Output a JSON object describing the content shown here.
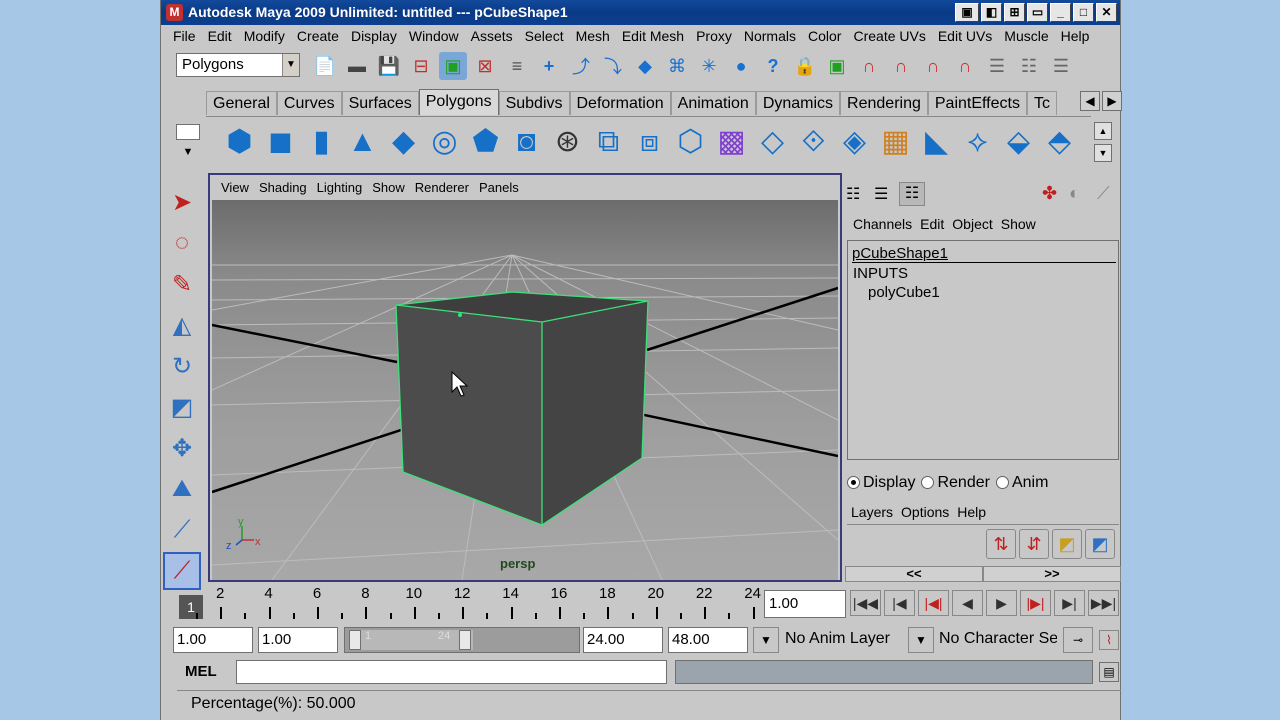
{
  "window": {
    "title": "Autodesk Maya 2009 Unlimited: untitled   ---   pCubeShape1"
  },
  "menubar": [
    "File",
    "Edit",
    "Modify",
    "Create",
    "Display",
    "Window",
    "Assets",
    "Select",
    "Mesh",
    "Edit Mesh",
    "Proxy",
    "Normals",
    "Color",
    "Create UVs",
    "Edit UVs",
    "Muscle",
    "Help"
  ],
  "status_line": {
    "mode": "Polygons"
  },
  "shelf_tabs": [
    {
      "label": "General",
      "active": false
    },
    {
      "label": "Curves",
      "active": false
    },
    {
      "label": "Surfaces",
      "active": false
    },
    {
      "label": "Polygons",
      "active": true
    },
    {
      "label": "Subdivs",
      "active": false
    },
    {
      "label": "Deformation",
      "active": false
    },
    {
      "label": "Animation",
      "active": false
    },
    {
      "label": "Dynamics",
      "active": false
    },
    {
      "label": "Rendering",
      "active": false
    },
    {
      "label": "PaintEffects",
      "active": false
    },
    {
      "label": "Tc",
      "active": false
    }
  ],
  "viewport": {
    "menu": [
      "View",
      "Shading",
      "Lighting",
      "Show",
      "Renderer",
      "Panels"
    ],
    "camera_label": "persp",
    "axis_labels": {
      "x": "x",
      "y": "y",
      "z": "z"
    },
    "selection_color": "#3ee07a"
  },
  "channel_box": {
    "menu": [
      "Channels",
      "Edit",
      "Object",
      "Show"
    ],
    "shape": "pCubeShape1",
    "inputs_label": "INPUTS",
    "input_node": "polyCube1"
  },
  "layer_editor": {
    "modes": [
      {
        "label": "Display",
        "selected": true
      },
      {
        "label": "Render",
        "selected": false
      },
      {
        "label": "Anim",
        "selected": false
      }
    ],
    "menu": [
      "Layers",
      "Options",
      "Help"
    ],
    "nav_left": "<<",
    "nav_right": ">>"
  },
  "time_slider": {
    "current_frame_marker": "1",
    "ticks": [
      "2",
      "4",
      "6",
      "8",
      "10",
      "12",
      "14",
      "16",
      "18",
      "20",
      "22",
      "24"
    ],
    "current_time": "1.00"
  },
  "range_slider": {
    "start_time": "1.00",
    "playback_start": "1.00",
    "range_start_label": "1",
    "range_end_label": "24",
    "playback_end": "24.00",
    "end_time": "48.00",
    "anim_layer": "No Anim Layer",
    "character_set": "No Character Se"
  },
  "command_line": {
    "label": "MEL",
    "value": ""
  },
  "help_line": {
    "text": "Percentage(%): 50.000"
  }
}
